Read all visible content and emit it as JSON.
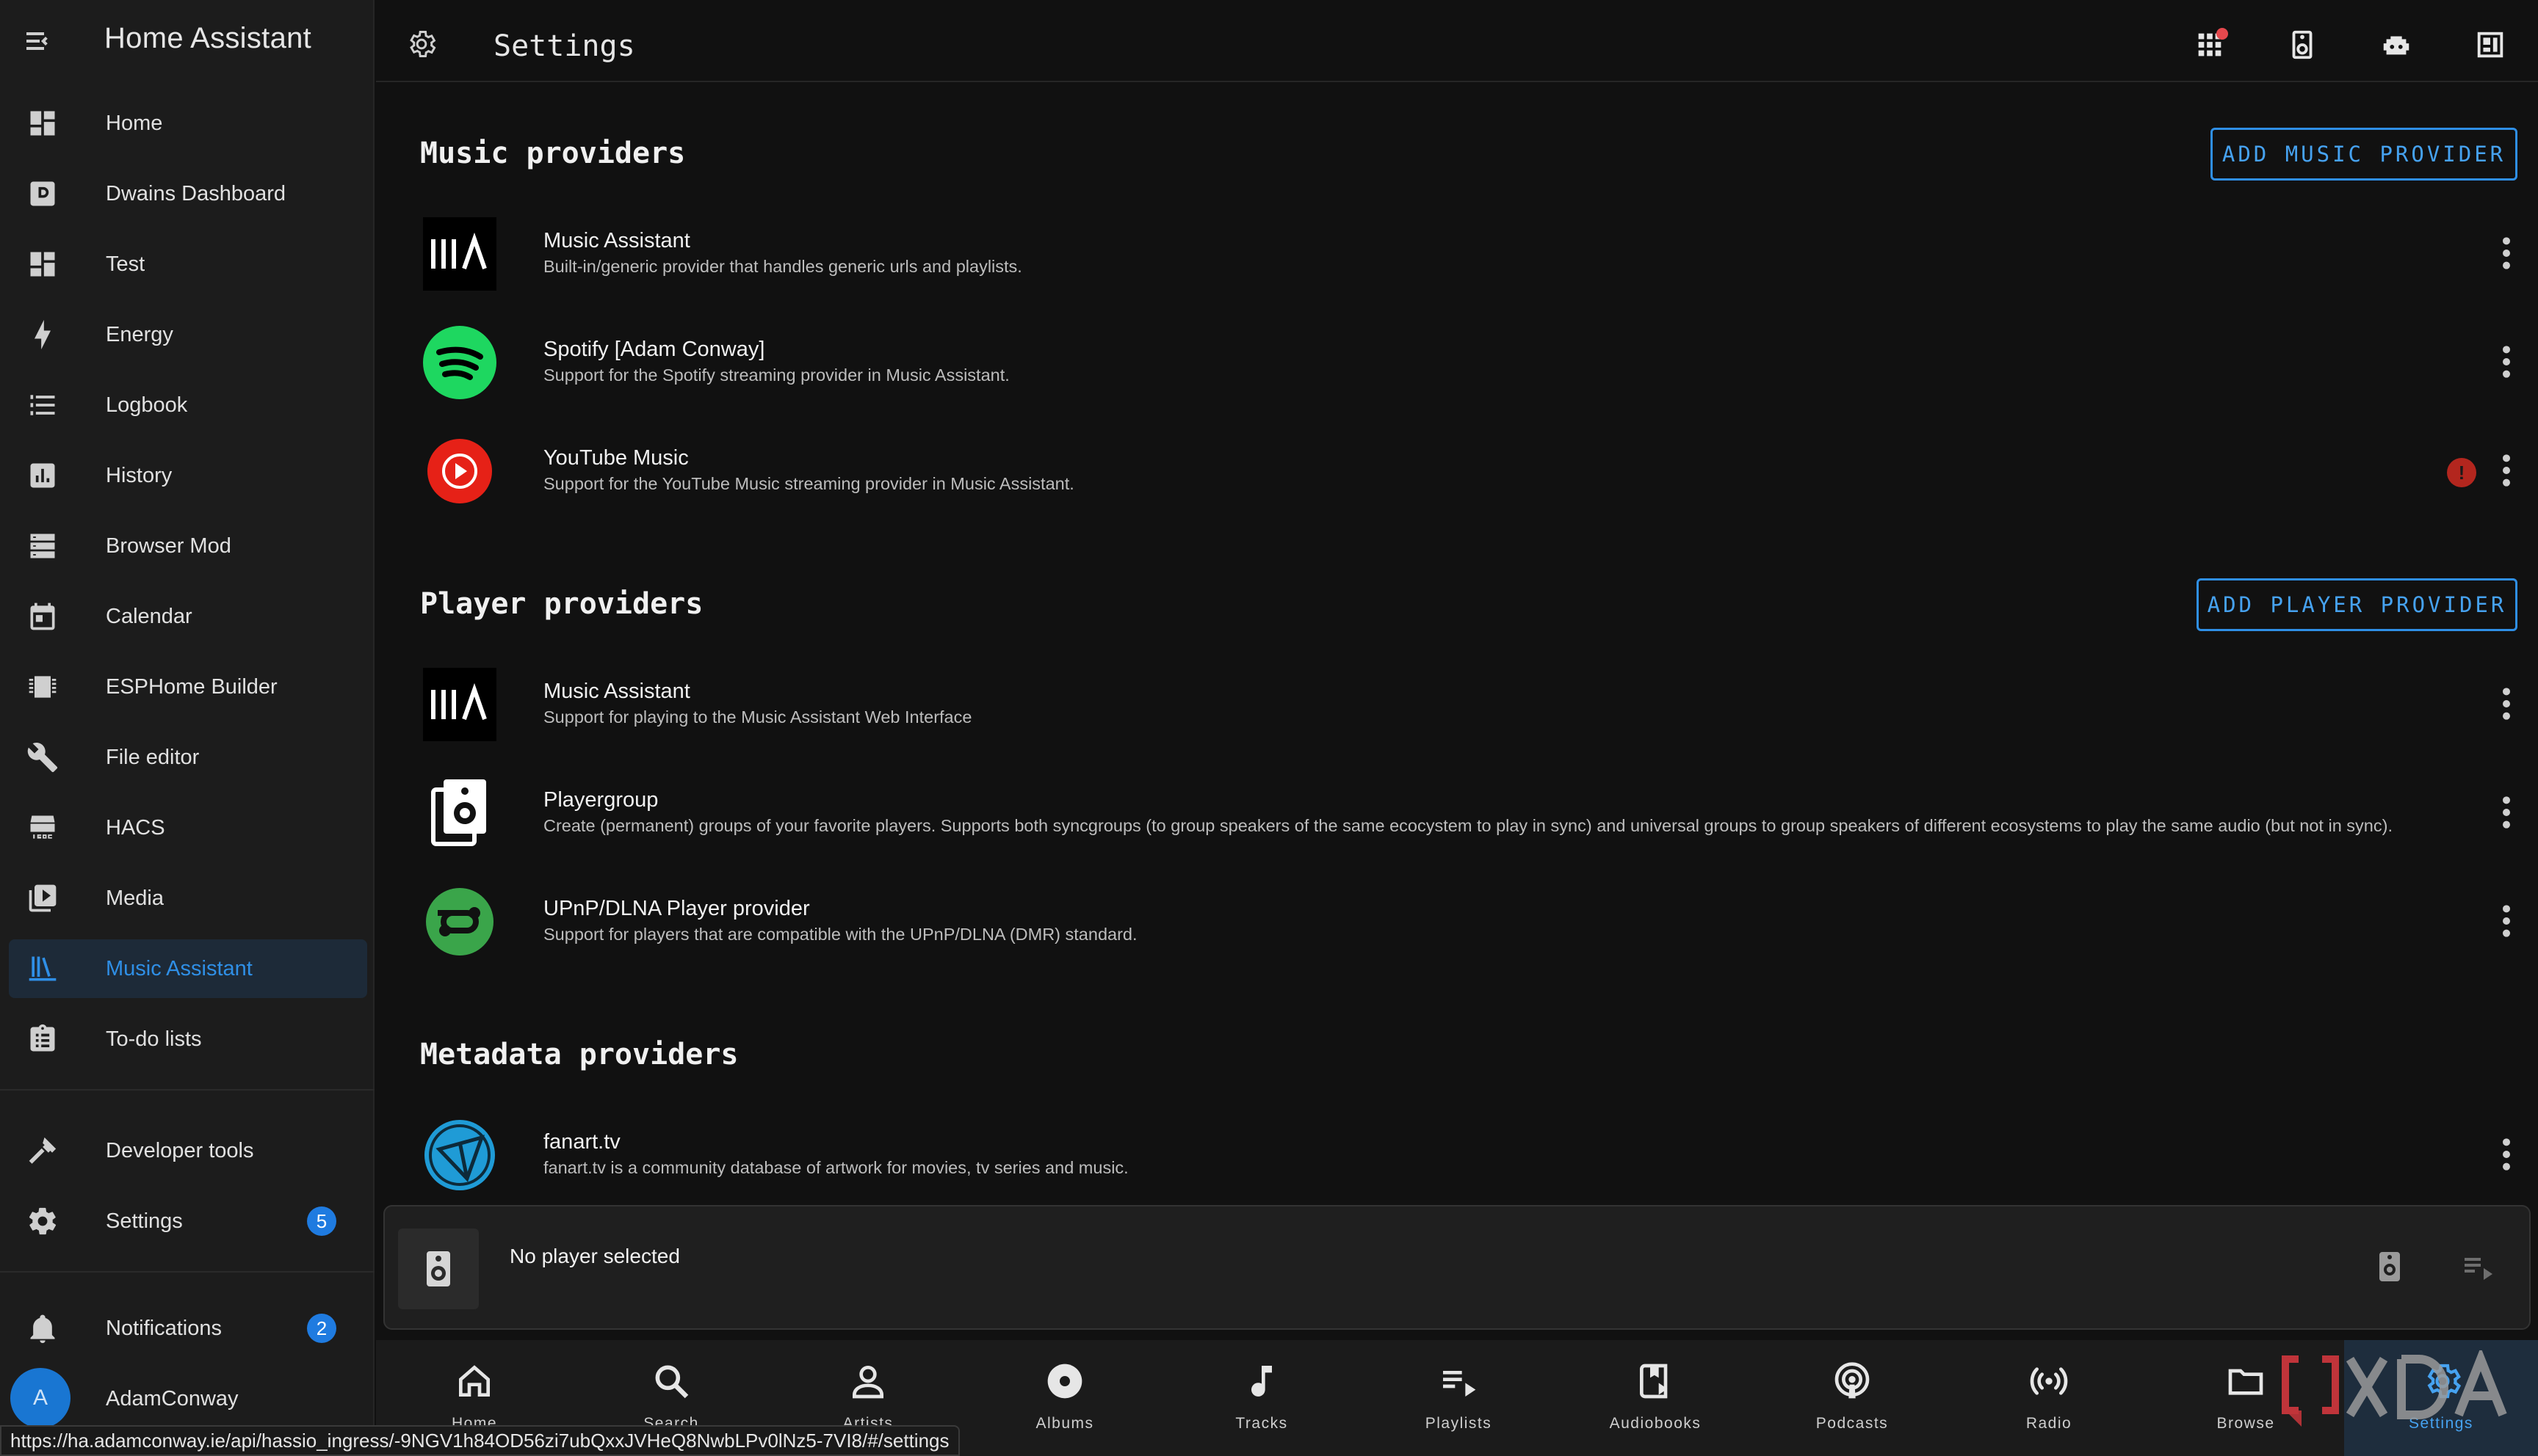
{
  "sidebar": {
    "title": "Home Assistant",
    "items": [
      {
        "label": "Home",
        "icon": "dashboard-icon"
      },
      {
        "label": "Dwains Dashboard",
        "icon": "d-square-icon"
      },
      {
        "label": "Test",
        "icon": "dashboard-icon"
      },
      {
        "label": "Energy",
        "icon": "lightning-icon"
      },
      {
        "label": "Logbook",
        "icon": "list-icon"
      },
      {
        "label": "History",
        "icon": "chart-box-icon"
      },
      {
        "label": "Browser Mod",
        "icon": "server-icon"
      },
      {
        "label": "Calendar",
        "icon": "calendar-icon"
      },
      {
        "label": "ESPHome Builder",
        "icon": "chip-icon"
      },
      {
        "label": "File editor",
        "icon": "wrench-icon"
      },
      {
        "label": "HACS",
        "icon": "hacs-icon"
      },
      {
        "label": "Media",
        "icon": "media-play-icon"
      },
      {
        "label": "Music Assistant",
        "icon": "library-icon"
      },
      {
        "label": "To-do lists",
        "icon": "clipboard-list-icon"
      }
    ],
    "developer_tools": "Developer tools",
    "settings": "Settings",
    "settings_badge": "5",
    "notifications": "Notifications",
    "notifications_badge": "2",
    "user_initial": "A",
    "user_name": "AdamConway"
  },
  "status_url": "https://ha.adamconway.ie/api/hassio_ingress/-9NGV1h84OD56zi7ubQxxJVHeQ8NwbLPv0lNz5-7VI8/#/settings",
  "topbar": {
    "title": "Settings"
  },
  "sections": {
    "music": {
      "title": "Music providers",
      "button": "ADD MUSIC PROVIDER",
      "providers": [
        {
          "name": "Music Assistant",
          "desc": "Built-in/generic provider that handles generic urls and playlists."
        },
        {
          "name": "Spotify [Adam Conway]",
          "desc": "Support for the Spotify streaming provider in Music Assistant."
        },
        {
          "name": "YouTube Music",
          "desc": "Support for the YouTube Music streaming provider in Music Assistant.",
          "error": "!"
        }
      ]
    },
    "player": {
      "title": "Player providers",
      "button": "ADD PLAYER PROVIDER",
      "providers": [
        {
          "name": "Music Assistant",
          "desc": "Support for playing to the Music Assistant Web Interface"
        },
        {
          "name": "Playergroup",
          "desc": "Create (permanent) groups of your favorite players. Supports both syncgroups (to group speakers of the same ecocystem to play in sync) and universal groups to group speakers of different ecosystems to play the same audio (but not in sync)."
        },
        {
          "name": "UPnP/DLNA Player provider",
          "desc": "Support for players that are compatible with the UPnP/DLNA (DMR) standard."
        }
      ]
    },
    "metadata": {
      "title": "Metadata providers",
      "providers": [
        {
          "name": "fanart.tv",
          "desc": "fanart.tv is a community database of artwork for movies, tv series and music."
        }
      ]
    }
  },
  "player_bar": {
    "text": "No player selected"
  },
  "bottom_nav": [
    {
      "label": "Home",
      "icon": "home-icon"
    },
    {
      "label": "Search",
      "icon": "search-icon"
    },
    {
      "label": "Artists",
      "icon": "person-icon"
    },
    {
      "label": "Albums",
      "icon": "disc-icon"
    },
    {
      "label": "Tracks",
      "icon": "music-note-icon"
    },
    {
      "label": "Playlists",
      "icon": "playlist-play-icon"
    },
    {
      "label": "Audiobooks",
      "icon": "book-play-icon"
    },
    {
      "label": "Podcasts",
      "icon": "podcast-icon"
    },
    {
      "label": "Radio",
      "icon": "radio-waves-icon"
    },
    {
      "label": "Browse",
      "icon": "folder-icon"
    },
    {
      "label": "Settings",
      "icon": "gear-icon",
      "active": true
    }
  ],
  "colors": {
    "accent": "#2f8fe6",
    "background": "#111111",
    "sidebar": "#1c1c1c",
    "error": "#b3261e",
    "spotify": "#1ed760",
    "youtube": "#e62117",
    "upnp": "#3aa54a",
    "fanart": "#1f9bd6"
  }
}
